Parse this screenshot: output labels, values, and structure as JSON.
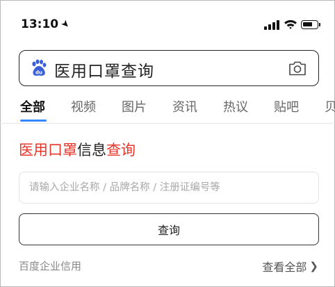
{
  "status_bar": {
    "time": "13:10",
    "location_icon": "location-arrow-icon",
    "signal_icon": "cellular-signal-icon",
    "wifi_icon": "wifi-icon",
    "battery_icon": "battery-icon",
    "battery_level": 0.7
  },
  "search": {
    "logo_icon": "baidu-paw-icon",
    "query": "医用口罩查询",
    "camera_icon": "camera-icon"
  },
  "tabs": [
    {
      "label": "全部",
      "active": true
    },
    {
      "label": "视频",
      "active": false
    },
    {
      "label": "图片",
      "active": false
    },
    {
      "label": "资讯",
      "active": false
    },
    {
      "label": "热议",
      "active": false
    },
    {
      "label": "贴吧",
      "active": false
    },
    {
      "label": "贝",
      "active": false
    }
  ],
  "card": {
    "title_part1": "医用口罩",
    "title_part2": "信息",
    "title_part3": "查询",
    "accent_color": "#e8352a",
    "input_placeholder": "请输入企业名称 / 品牌名称 / 注册证编号等",
    "input_value": "",
    "button_label": "查询",
    "source_label": "百度企业信用",
    "view_all_label": "查看全部"
  },
  "colors": {
    "tab_underline": "#3388ff",
    "text_primary": "#222222"
  }
}
